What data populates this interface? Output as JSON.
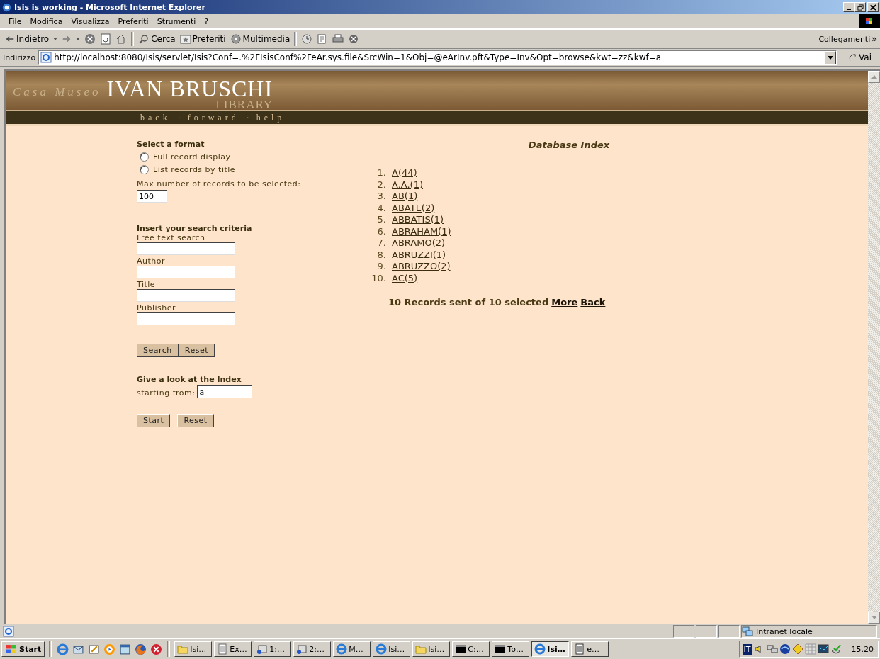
{
  "window": {
    "title": "Isis is working - Microsoft Internet Explorer"
  },
  "menu": [
    "File",
    "Modifica",
    "Visualizza",
    "Preferiti",
    "Strumenti",
    "?"
  ],
  "toolbar": {
    "buttons": [
      {
        "kind": "back",
        "label": "Indietro"
      },
      {
        "kind": "forward"
      },
      {
        "kind": "stop"
      },
      {
        "kind": "refresh"
      },
      {
        "kind": "home"
      },
      {
        "kind": "search",
        "label": "Cerca"
      },
      {
        "kind": "favorites",
        "label": "Preferiti"
      },
      {
        "kind": "media",
        "label": "Multimedia"
      },
      {
        "kind": "history"
      },
      {
        "kind": "mail"
      },
      {
        "kind": "print"
      },
      {
        "kind": "messenger"
      }
    ],
    "links_label": "Collegamenti",
    "links_chevron": "»"
  },
  "address": {
    "label": "Indirizzo",
    "url": "http://localhost:8080/Isis/servlet/Isis?Conf=.%2FIsisConf%2FeAr.sys.file&SrcWin=1&Obj=@eArInv.pft&Type=Inv&Opt=browse&kwt=zz&kwf=a",
    "go": "Vai"
  },
  "header": {
    "prefix": "Casa Museo",
    "title": "IVAN BRUSCHI",
    "subtitle": "LIBRARY",
    "nav": [
      {
        "kind": "link",
        "label": "back"
      },
      {
        "kind": "separator",
        "label": "·"
      },
      {
        "kind": "link",
        "label": "forward"
      },
      {
        "kind": "separator",
        "label": "·"
      },
      {
        "kind": "link",
        "label": "help"
      }
    ]
  },
  "format": {
    "heading": "Select a format",
    "options": [
      {
        "label": "Full record display",
        "selected": false
      },
      {
        "label": "List records by title",
        "selected": false
      }
    ],
    "max_label": "Max number of records to be selected:",
    "max_value": "100"
  },
  "search": {
    "heading": "Insert your search criteria",
    "fields": [
      {
        "label": "Free text search"
      },
      {
        "label": "Author"
      },
      {
        "label": "Title"
      },
      {
        "label": "Publisher"
      }
    ],
    "buttons": [
      "Search",
      "Reset"
    ]
  },
  "index_lookup": {
    "heading": "Give a look at the Index",
    "label": "starting from:",
    "value": "a",
    "buttons": [
      "Start",
      "Reset"
    ]
  },
  "results": {
    "title": "Database Index",
    "entries": [
      {
        "number": "1.",
        "term": "A(44)"
      },
      {
        "number": "2.",
        "term": "A.A.(1)"
      },
      {
        "number": "3.",
        "term": "AB(1)"
      },
      {
        "number": "4.",
        "term": "ABATE(2)"
      },
      {
        "number": "5.",
        "term": "ABBATIS(1)"
      },
      {
        "number": "6.",
        "term": "ABRAHAM(1)"
      },
      {
        "number": "7.",
        "term": "ABRAMO(2)"
      },
      {
        "number": "8.",
        "term": "ABRUZZI(1)"
      },
      {
        "number": "9.",
        "term": "ABRUZZO(2)"
      },
      {
        "number": "10.",
        "term": "AC(5)"
      }
    ],
    "summary": "10 Records sent of 10 selected",
    "links": [
      "More",
      "Back"
    ]
  },
  "status_bar": {
    "zone": "Intranet locale"
  },
  "taskbar": {
    "start": "Start",
    "tasks": [
      {
        "kind": "folder",
        "label": "Isi…",
        "selected": false
      },
      {
        "kind": "document",
        "label": "Ex…",
        "selected": false
      },
      {
        "kind": "app",
        "label": "1:…",
        "selected": false
      },
      {
        "kind": "app",
        "label": "2:…",
        "selected": false
      },
      {
        "kind": "browser",
        "label": "M…",
        "selected": false
      },
      {
        "kind": "browser",
        "label": "Isi…",
        "selected": false
      },
      {
        "kind": "folder",
        "label": "Isi…",
        "selected": false
      },
      {
        "kind": "console",
        "label": "C:…",
        "selected": false
      },
      {
        "kind": "console",
        "label": "To…",
        "selected": false
      },
      {
        "kind": "browser",
        "label": "Isi…",
        "selected": true
      },
      {
        "kind": "notepad",
        "label": "e…",
        "selected": false
      }
    ],
    "language": "IT",
    "clock": "15.20"
  }
}
